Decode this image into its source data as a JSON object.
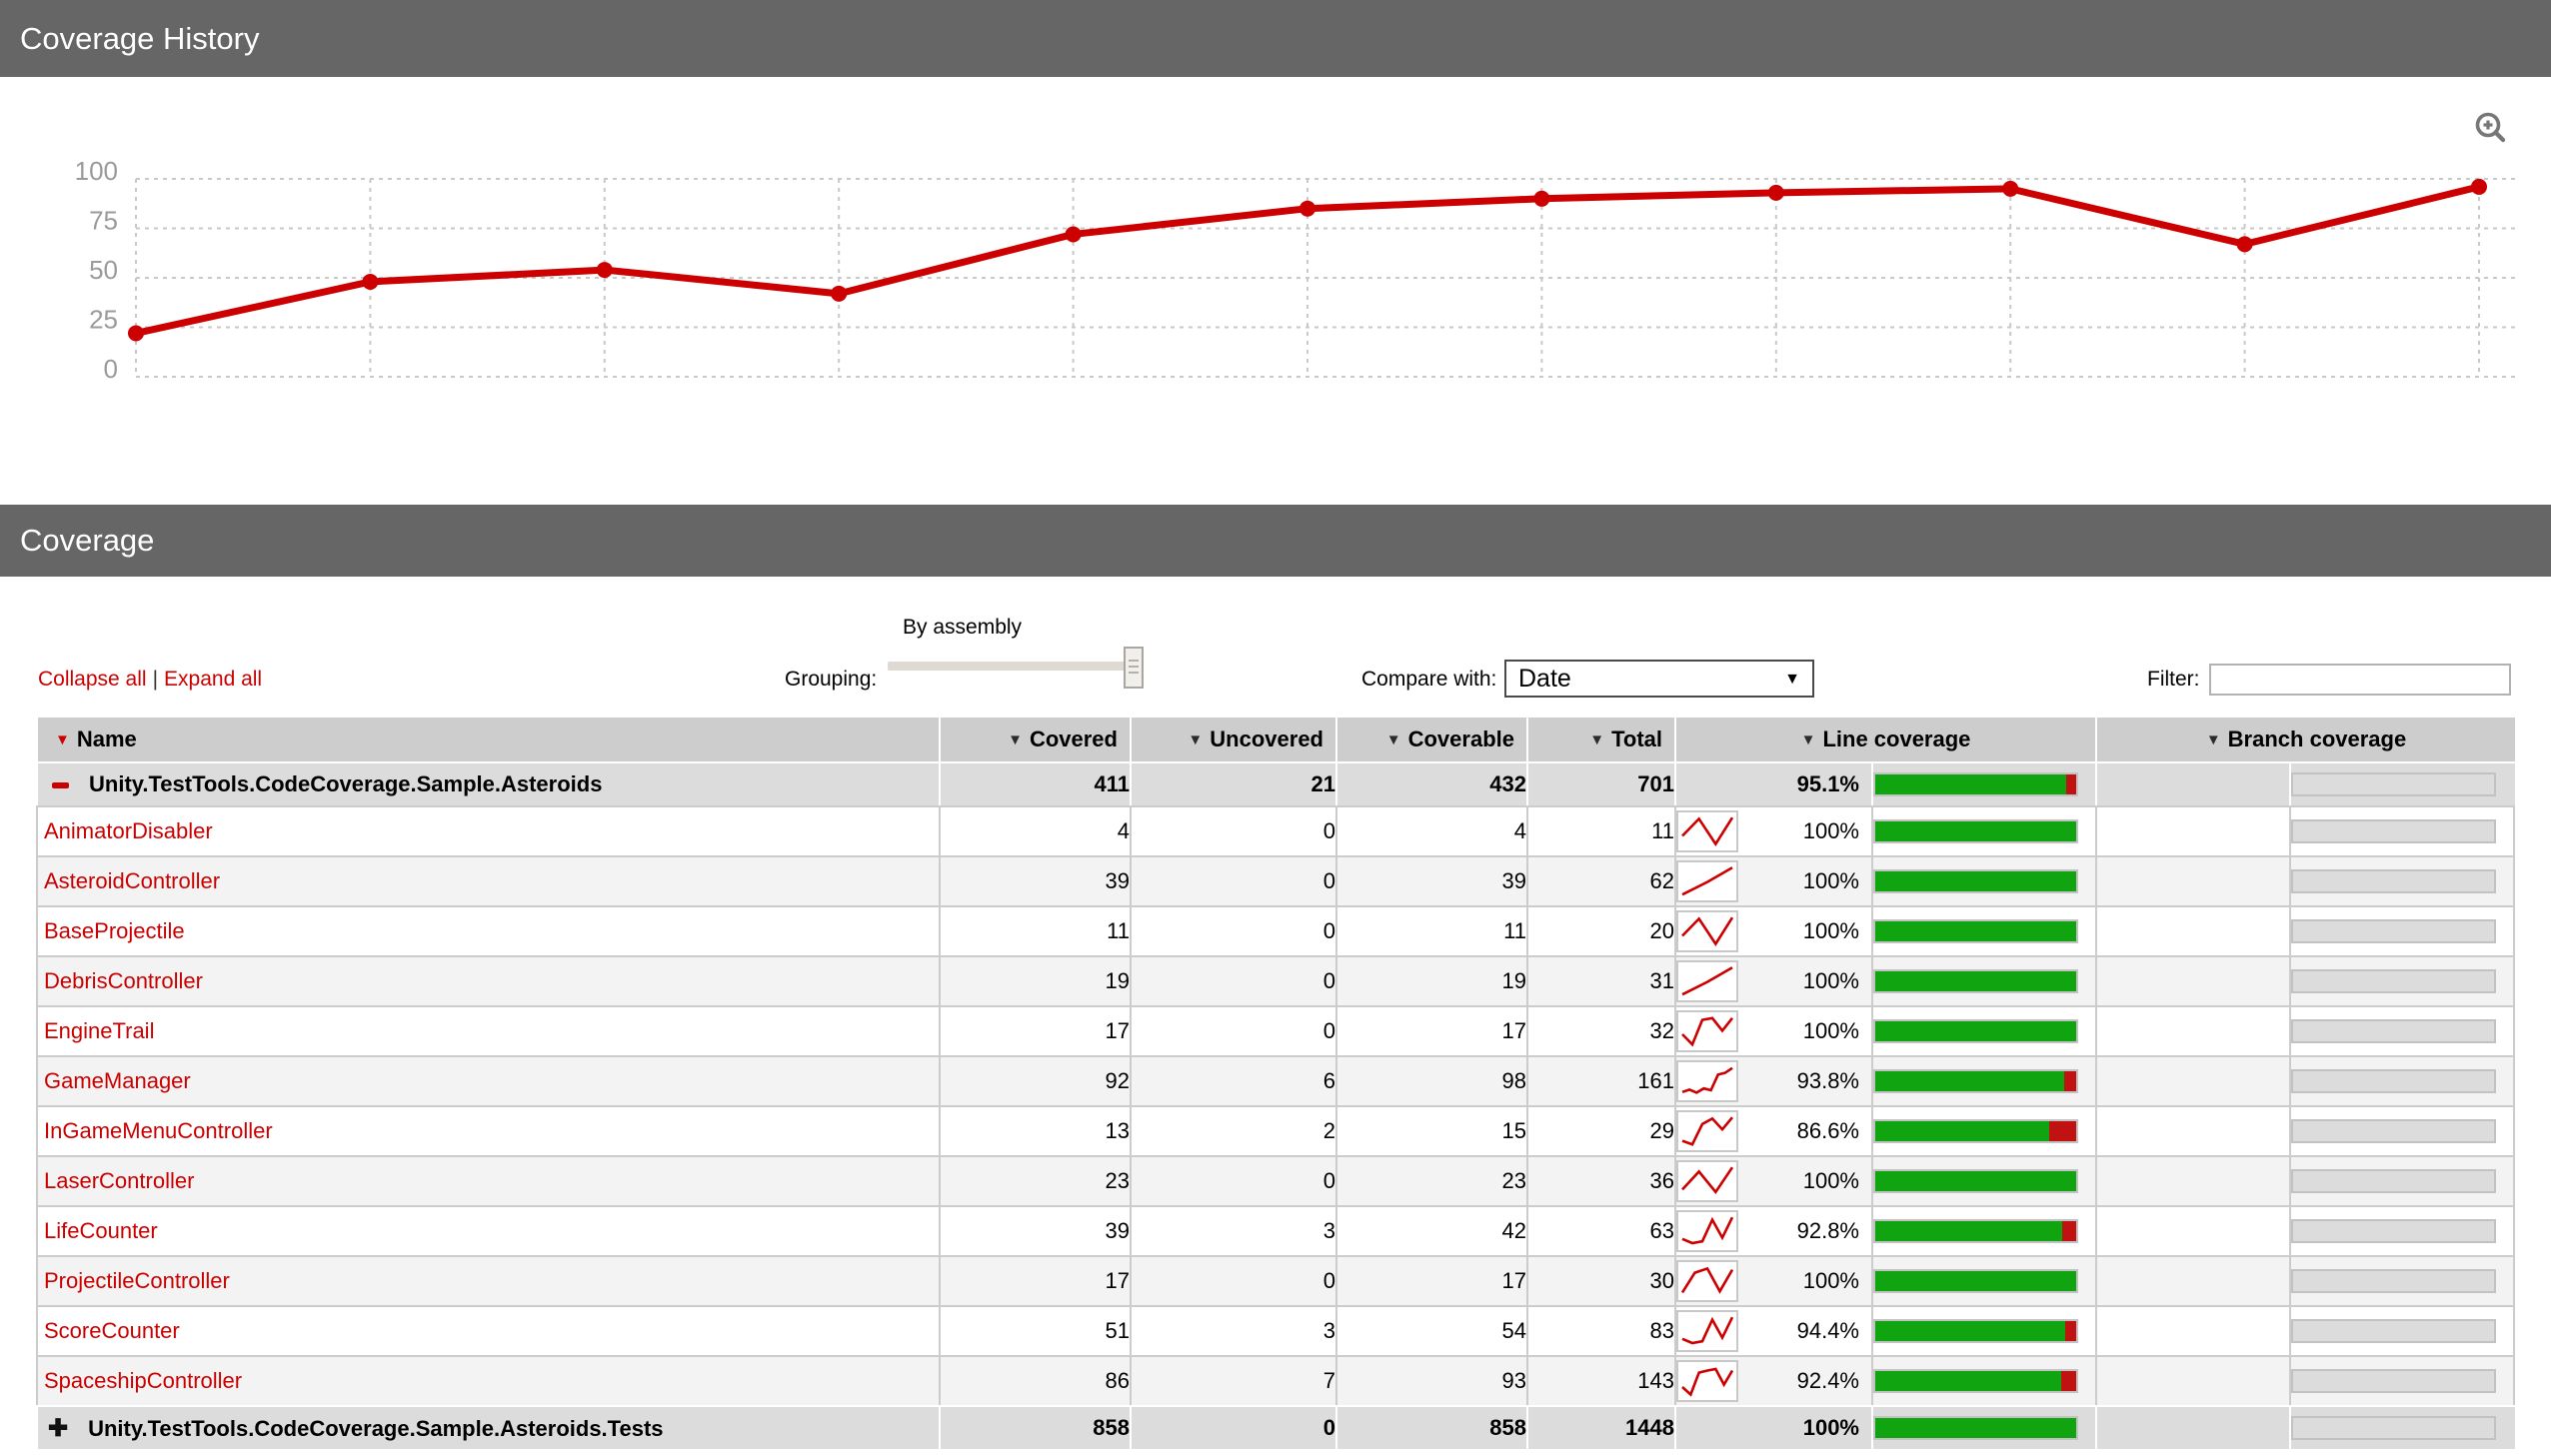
{
  "sections": {
    "history_title": "Coverage History",
    "coverage_title": "Coverage"
  },
  "chart_data": {
    "type": "line",
    "title": "Coverage History",
    "values": [
      22,
      48,
      54,
      42,
      72,
      85,
      90,
      93,
      95,
      67,
      96
    ],
    "y_ticks": [
      100,
      75,
      50,
      25,
      0
    ],
    "ylim": [
      0,
      100
    ],
    "line_color": "#cc0000",
    "grid": "dashed",
    "legend": "none"
  },
  "controls": {
    "collapse_all": "Collapse all",
    "separator": "|",
    "expand_all": "Expand all",
    "grouping_label": "Grouping:",
    "grouping_value": "By assembly",
    "compare_label": "Compare with:",
    "compare_value": "Date",
    "filter_label": "Filter:",
    "filter_value": ""
  },
  "table": {
    "columns": [
      "Name",
      "Covered",
      "Uncovered",
      "Coverable",
      "Total",
      "Line coverage",
      "Branch coverage"
    ],
    "sorted_column": "Name",
    "rows": [
      {
        "name": "Unity.TestTools.CodeCoverage.Sample.Asteroids",
        "kind": "assembly",
        "icon": "minus-icon",
        "covered": "411",
        "uncovered": "21",
        "coverable": "432",
        "total": "701",
        "line_coverage": "95.1%",
        "line_pct": 95.1,
        "spark": null,
        "branch_coverage": ""
      },
      {
        "name": "AnimatorDisabler",
        "kind": "class",
        "covered": "4",
        "uncovered": "0",
        "coverable": "4",
        "total": "11",
        "line_coverage": "100%",
        "line_pct": 100,
        "spark": [
          35,
          92,
          8,
          96
        ],
        "branch_coverage": ""
      },
      {
        "name": "AsteroidController",
        "kind": "class",
        "covered": "39",
        "uncovered": "0",
        "coverable": "39",
        "total": "62",
        "line_coverage": "100%",
        "line_pct": 100,
        "spark": [
          6,
          48,
          96
        ],
        "branch_coverage": ""
      },
      {
        "name": "BaseProjectile",
        "kind": "class",
        "covered": "11",
        "uncovered": "0",
        "coverable": "11",
        "total": "20",
        "line_coverage": "100%",
        "line_pct": 100,
        "spark": [
          35,
          92,
          8,
          96
        ],
        "branch_coverage": ""
      },
      {
        "name": "DebrisController",
        "kind": "class",
        "covered": "19",
        "uncovered": "0",
        "coverable": "19",
        "total": "31",
        "line_coverage": "100%",
        "line_pct": 100,
        "spark": [
          6,
          48,
          96
        ],
        "branch_coverage": ""
      },
      {
        "name": "EngineTrail",
        "kind": "class",
        "covered": "17",
        "uncovered": "0",
        "coverable": "17",
        "total": "32",
        "line_coverage": "100%",
        "line_pct": 100,
        "spark": [
          40,
          6,
          88,
          94,
          52,
          94
        ],
        "branch_coverage": ""
      },
      {
        "name": "GameManager",
        "kind": "class",
        "covered": "92",
        "uncovered": "6",
        "coverable": "98",
        "total": "161",
        "line_coverage": "93.8%",
        "line_pct": 93.8,
        "spark": [
          14,
          22,
          12,
          26,
          20,
          72,
          78,
          94
        ],
        "branch_coverage": ""
      },
      {
        "name": "InGameMenuController",
        "kind": "class",
        "covered": "13",
        "uncovered": "2",
        "coverable": "15",
        "total": "29",
        "line_coverage": "86.6%",
        "line_pct": 86.6,
        "spark": [
          18,
          6,
          74,
          92,
          56,
          96
        ],
        "branch_coverage": ""
      },
      {
        "name": "LaserController",
        "kind": "class",
        "covered": "23",
        "uncovered": "0",
        "coverable": "23",
        "total": "36",
        "line_coverage": "100%",
        "line_pct": 100,
        "spark": [
          22,
          82,
          14,
          96
        ],
        "branch_coverage": ""
      },
      {
        "name": "LifeCounter",
        "kind": "class",
        "covered": "39",
        "uncovered": "3",
        "coverable": "42",
        "total": "63",
        "line_coverage": "92.8%",
        "line_pct": 92.8,
        "spark": [
          24,
          10,
          16,
          88,
          28,
          96
        ],
        "branch_coverage": ""
      },
      {
        "name": "ProjectileController",
        "kind": "class",
        "covered": "17",
        "uncovered": "0",
        "coverable": "17",
        "total": "30",
        "line_coverage": "100%",
        "line_pct": 100,
        "spark": [
          12,
          78,
          92,
          16,
          88
        ],
        "branch_coverage": ""
      },
      {
        "name": "ScoreCounter",
        "kind": "class",
        "covered": "51",
        "uncovered": "3",
        "coverable": "54",
        "total": "83",
        "line_coverage": "94.4%",
        "line_pct": 94.4,
        "spark": [
          24,
          10,
          16,
          88,
          28,
          96
        ],
        "branch_coverage": ""
      },
      {
        "name": "SpaceshipController",
        "kind": "class",
        "covered": "86",
        "uncovered": "7",
        "coverable": "93",
        "total": "143",
        "line_coverage": "92.4%",
        "line_pct": 92.4,
        "spark": [
          30,
          5,
          78,
          85,
          90,
          38,
          85
        ],
        "branch_coverage": ""
      },
      {
        "name": "Unity.TestTools.CodeCoverage.Sample.Asteroids.Tests",
        "kind": "assembly",
        "icon": "plus-icon",
        "covered": "858",
        "uncovered": "0",
        "coverable": "858",
        "total": "1448",
        "line_coverage": "100%",
        "line_pct": 100,
        "spark": null,
        "branch_coverage": ""
      }
    ]
  },
  "colors": {
    "section_bar": "#666666",
    "accent_red": "#cc0000",
    "bar_green": "#11a411",
    "bar_red": "#c11212",
    "grid": "#c9c9c9",
    "axis_label": "#9a9a9a"
  }
}
